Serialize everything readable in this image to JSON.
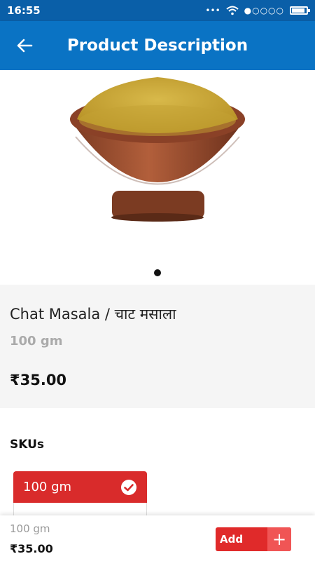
{
  "status_bar": {
    "time": "16:55",
    "icons": [
      "more-icon",
      "wifi-icon",
      "signal-icon",
      "battery-icon"
    ]
  },
  "app_bar": {
    "title": "Product Description",
    "back_icon": "back-arrow-icon"
  },
  "product": {
    "image_icon": "spice-bowl-image",
    "name": "Chat Masala / चाट मसाला",
    "weight": "100 gm",
    "price": "₹35.00"
  },
  "skus": {
    "label": "SKUs",
    "items": [
      {
        "label": "100 gm",
        "selected": true
      }
    ]
  },
  "bottom_bar": {
    "weight": "100 gm",
    "price": "₹35.00",
    "add_label": "Add",
    "plus_label": "+"
  },
  "colors": {
    "primary": "#0a73c4",
    "accent_red": "#d92b2b"
  }
}
